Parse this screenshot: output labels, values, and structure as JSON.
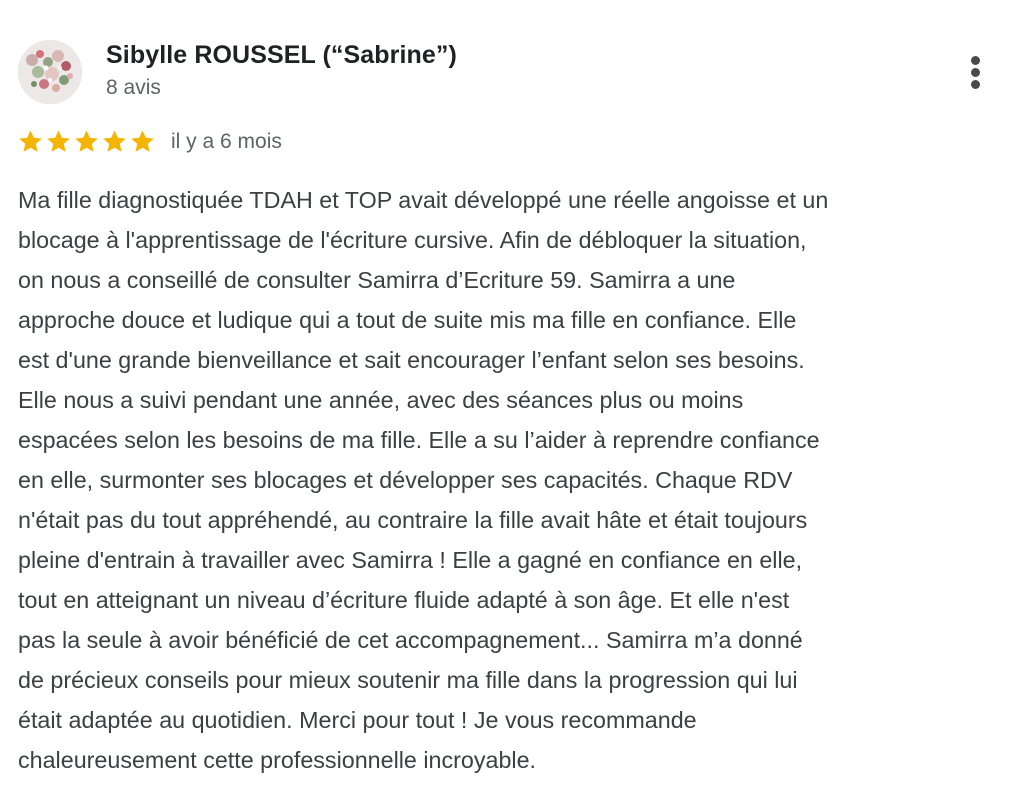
{
  "review": {
    "author": {
      "name": "Sibylle ROUSSEL (“Sabrine”)",
      "review_count": "8 avis",
      "avatar_icon": "floral-globe-avatar-icon"
    },
    "menu_icon": "more-vertical-icon",
    "rating": {
      "stars": 5,
      "max": 5,
      "star_icon": "star-icon",
      "star_color": "#F4B400"
    },
    "time_ago": "il y a 6 mois",
    "text_lines": [
      "Ma fille diagnostiquée TDAH et TOP avait développé une réelle angoisse et un",
      "blocage à l'apprentissage de l'écriture cursive. Afin de débloquer la situation,",
      "on nous a conseillé de consulter Samirra d’Ecriture 59. Samirra a une",
      "approche douce et ludique qui a tout de suite mis ma fille en confiance. Elle",
      "est d'une grande bienveillance et sait encourager l’enfant selon ses besoins.",
      "Elle nous a suivi pendant une année, avec des séances plus ou moins",
      "espacées selon les besoins de ma fille. Elle a su l’aider à reprendre confiance",
      "en elle, surmonter ses blocages et développer ses capacités. Chaque RDV",
      "n'était pas du tout appréhendé, au contraire la fille avait hâte et était toujours",
      "pleine d'entrain à travailler avec Samirra ! Elle a gagné en confiance en elle,",
      "tout en atteignant un niveau d’écriture fluide adapté à son âge. Et elle n'est",
      "pas la seule à avoir bénéficié de cet accompagnement... Samirra m’a donné",
      "de précieux conseils pour mieux soutenir ma fille dans la progression qui lui",
      "était adaptée au quotidien. Merci pour tout ! Je vous recommande",
      "chaleureusement cette professionnelle incroyable."
    ]
  }
}
